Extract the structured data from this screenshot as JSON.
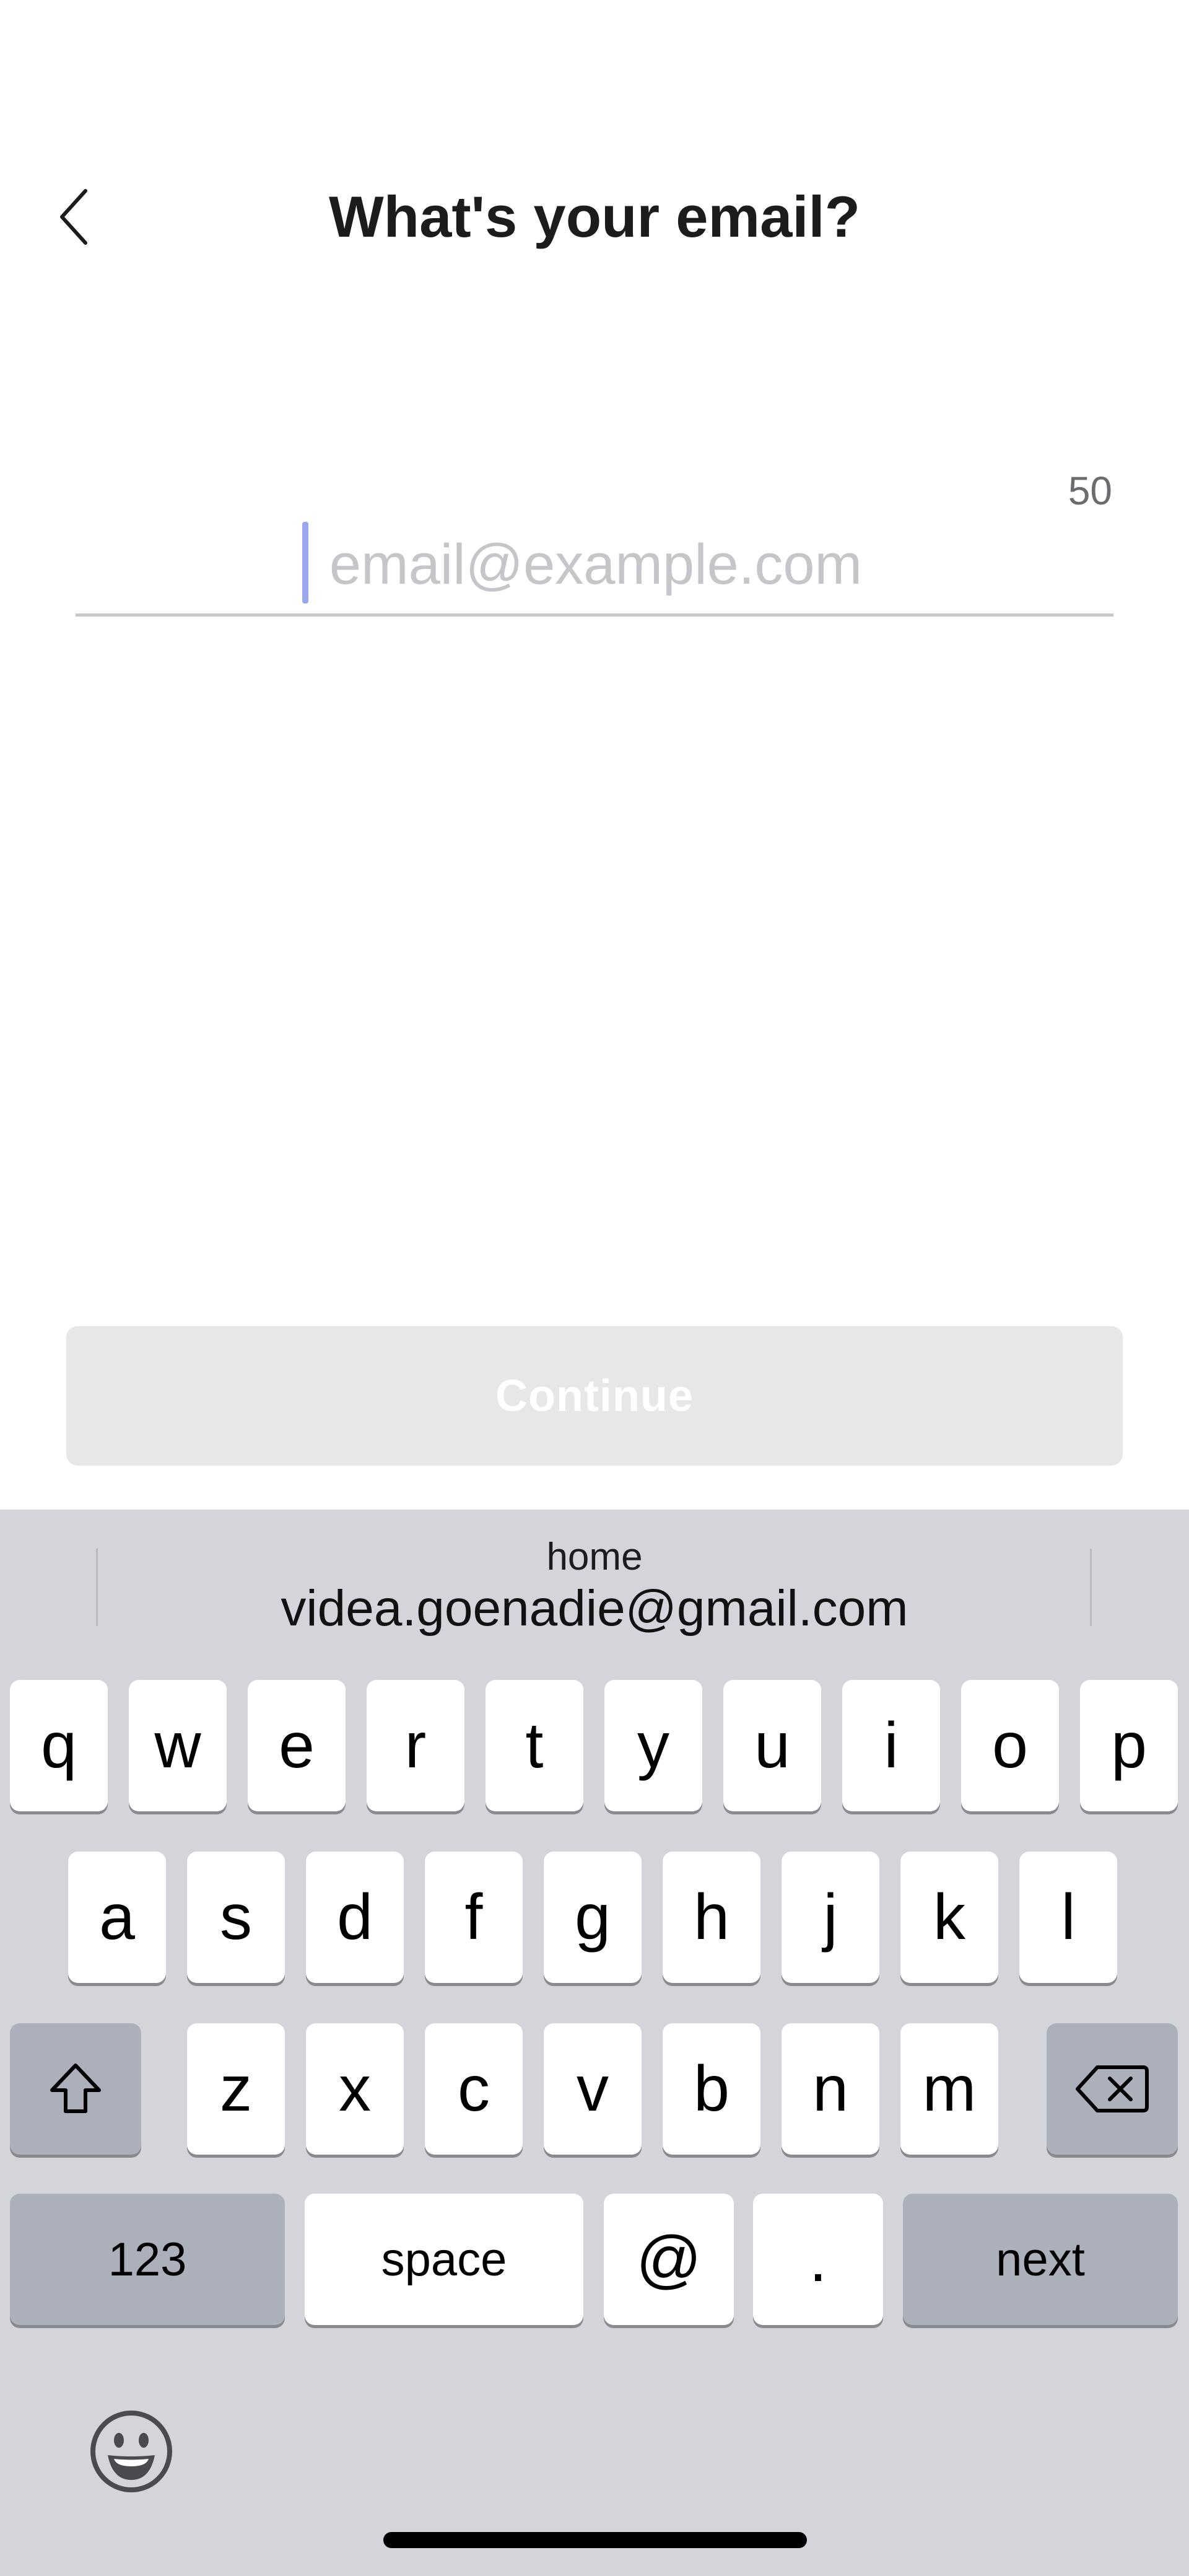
{
  "header": {
    "title": "What's your email?",
    "back_icon": "chevron-left-icon"
  },
  "email": {
    "value": "",
    "placeholder": "email@example.com",
    "char_counter": "50"
  },
  "continue_button": {
    "label": "Continue",
    "enabled": false
  },
  "keyboard": {
    "suggestion": {
      "label": "home",
      "value": "videa.goenadie@gmail.com"
    },
    "row1": [
      "q",
      "w",
      "e",
      "r",
      "t",
      "y",
      "u",
      "i",
      "o",
      "p"
    ],
    "row2": [
      "a",
      "s",
      "d",
      "f",
      "g",
      "h",
      "j",
      "k",
      "l"
    ],
    "row3": [
      "z",
      "x",
      "c",
      "v",
      "b",
      "n",
      "m"
    ],
    "shift_icon": "shift-icon",
    "delete_icon": "delete-icon",
    "numbers_label": "123",
    "space_label": "space",
    "at_label": "@",
    "dot_label": ".",
    "next_label": "next",
    "emoji_icon": "emoji-icon"
  },
  "colors": {
    "caret": "#9aa6ee",
    "keyboard_bg": "#d4d5da",
    "key_dark": "#abb0ba",
    "button_disabled": "#e6e7e9"
  }
}
